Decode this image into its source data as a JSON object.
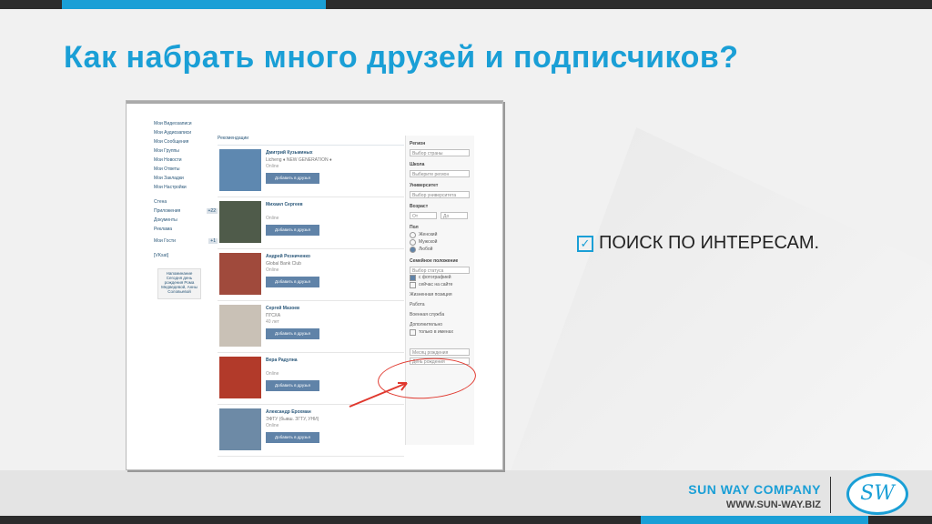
{
  "slide": {
    "title": "Как набрать много друзей и подписчиков?",
    "bullet": "ПОИСК ПО ИНТЕРЕСАМ.",
    "brand_name": "SUN WAY COMPANY",
    "brand_url": "WWW.SUN-WAY.BIZ",
    "logo_text": "SW",
    "accent_color": "#1a9fd6"
  },
  "screenshot": {
    "left_nav": [
      "Мои Видеозаписи",
      "Мои Аудиозаписи",
      "Мои Сообщения",
      "Мои Группы",
      "Мои Новости",
      "Мои Ответы",
      "Мои Закладки",
      "Мои Настройки"
    ],
    "left_nav2": [
      {
        "label": "Стена",
        "count": ""
      },
      {
        "label": "Приложения",
        "count": "+22"
      },
      {
        "label": "Документы",
        "count": ""
      },
      {
        "label": "Реклама",
        "count": ""
      },
      {
        "label": "Мои Гости",
        "count": "+1"
      }
    ],
    "vk_link": "[VKsat]",
    "promo_text": "Напоминание Сегодня день рождения Рома Медведевой, Анны Соловьевой",
    "section_title": "Рекомендации",
    "add_button": "Добавить в друзья",
    "people": [
      {
        "name": "Дмитрий Кузьминых",
        "sub": "Licheng ♦ NEW GENERATION ♦",
        "status": "Online"
      },
      {
        "name": "Михаил Сергеев",
        "sub": "",
        "status": "Online"
      },
      {
        "name": "Андрей Резниченко",
        "sub": "Global Bank Club",
        "status": "Online"
      },
      {
        "name": "Сергей Мазоев",
        "sub": "ПГСХА",
        "status": "40 лет"
      },
      {
        "name": "Вера Радулна",
        "sub": "",
        "status": "Online"
      },
      {
        "name": "Александр Ерохман",
        "sub": "ЭФТУ (бывш. ЗГТУ, УНИ)",
        "status": "Online"
      }
    ],
    "filters": {
      "region_label": "Регион",
      "region_value": "Выбор страны",
      "school_label": "Школа",
      "school_value": "Выберите регион",
      "uni_label": "Университет",
      "uni_value": "Выбор университета",
      "age_label": "Возраст",
      "age_from": "От",
      "age_to": "До",
      "sex_label": "Пол",
      "sex_options": [
        "Женский",
        "Мужской",
        "Любой"
      ],
      "family_label": "Семейное положение",
      "family_value": "Выбор статуса",
      "photo_check": "с фотографией",
      "online_check": "сейчас на сайте",
      "life_label": "Жизненная позиция",
      "work_label": "Работа",
      "military_label": "Военная служба",
      "extra_label": "Дополнительно",
      "names_check": "только в именах",
      "month_value": "Месяц рождения",
      "day_value": "День рождения"
    }
  }
}
